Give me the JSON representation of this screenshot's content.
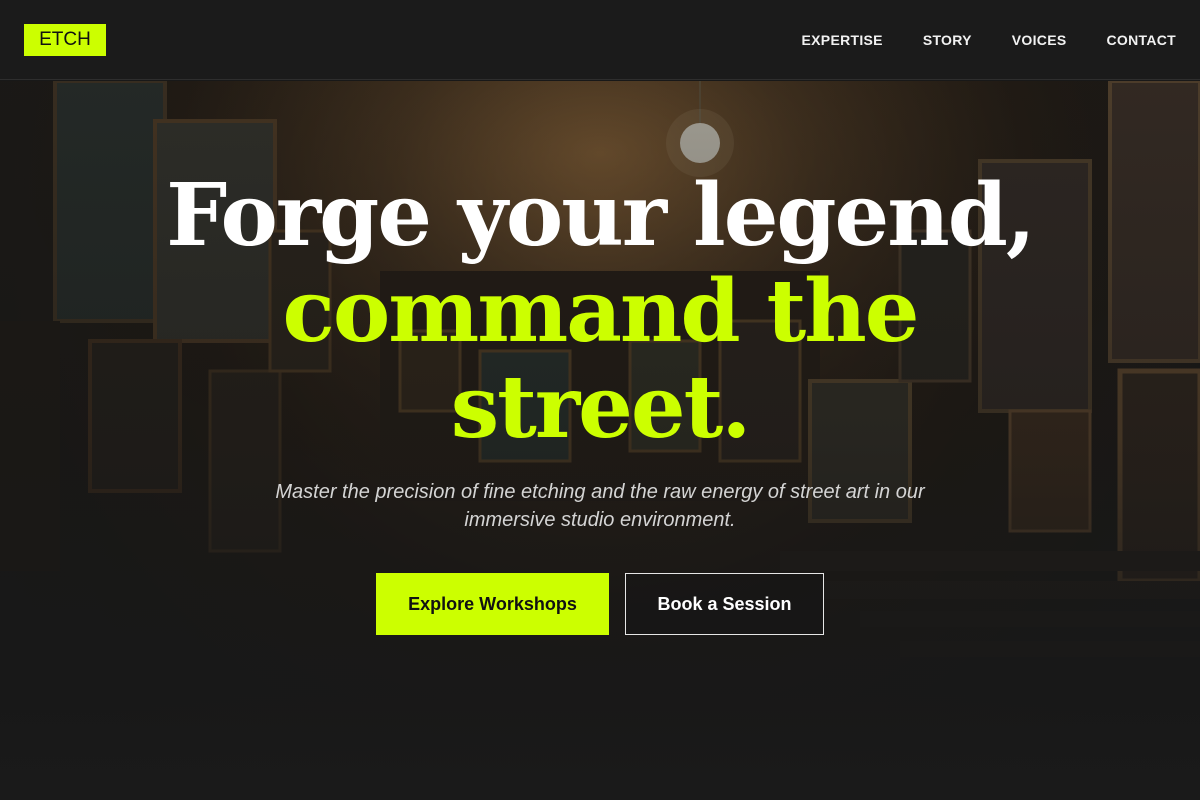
{
  "brand": {
    "logo": "ETCH",
    "accent_color": "#ccff00"
  },
  "nav": {
    "items": [
      {
        "label": "EXPERTISE"
      },
      {
        "label": "STORY"
      },
      {
        "label": "VOICES"
      },
      {
        "label": "CONTACT"
      }
    ]
  },
  "hero": {
    "headline_line1": "Forge your legend,",
    "headline_line2": "command the",
    "headline_line3": "street.",
    "subtitle": "Master the precision of fine etching and the raw energy of street art in our immersive studio environment.",
    "primary_button": "Explore Workshops",
    "secondary_button": "Book a Session"
  }
}
